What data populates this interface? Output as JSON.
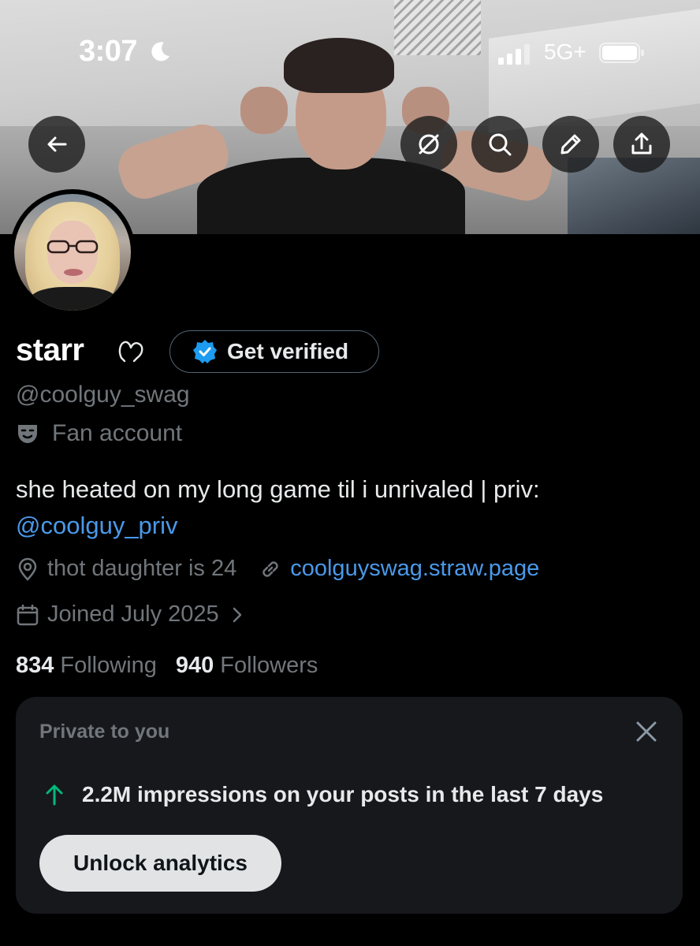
{
  "status_bar": {
    "time": "3:07",
    "network": "5G+"
  },
  "profile": {
    "display_name": "starr",
    "verify_button": "Get verified",
    "handle": "@coolguy_swag",
    "account_label": "Fan account",
    "bio_text": "she heated on my long game til i unrivaled | priv:",
    "bio_mention": "@coolguy_priv",
    "location": "thot daughter is 24",
    "website": "coolguyswag.straw.page",
    "joined": "Joined July 2025",
    "following_count": "834",
    "following_label": "Following",
    "followers_count": "940",
    "followers_label": "Followers"
  },
  "private_card": {
    "title": "Private to you",
    "impressions_text": "2.2M impressions on your posts in the last 7 days",
    "unlock_button": "Unlock analytics"
  },
  "colors": {
    "accent": "#4a99e9",
    "growth_green": "#00ba7c",
    "verified_blue": "#1d9bf0"
  },
  "icons": [
    "back-arrow-icon",
    "grok-icon",
    "search-icon",
    "edit-icon",
    "share-icon",
    "moon-icon",
    "signal-icon",
    "battery-icon",
    "verified-badge-icon",
    "mask-icon",
    "location-icon",
    "link-icon",
    "calendar-icon",
    "chevron-right-icon",
    "close-icon",
    "arrow-up-icon"
  ]
}
